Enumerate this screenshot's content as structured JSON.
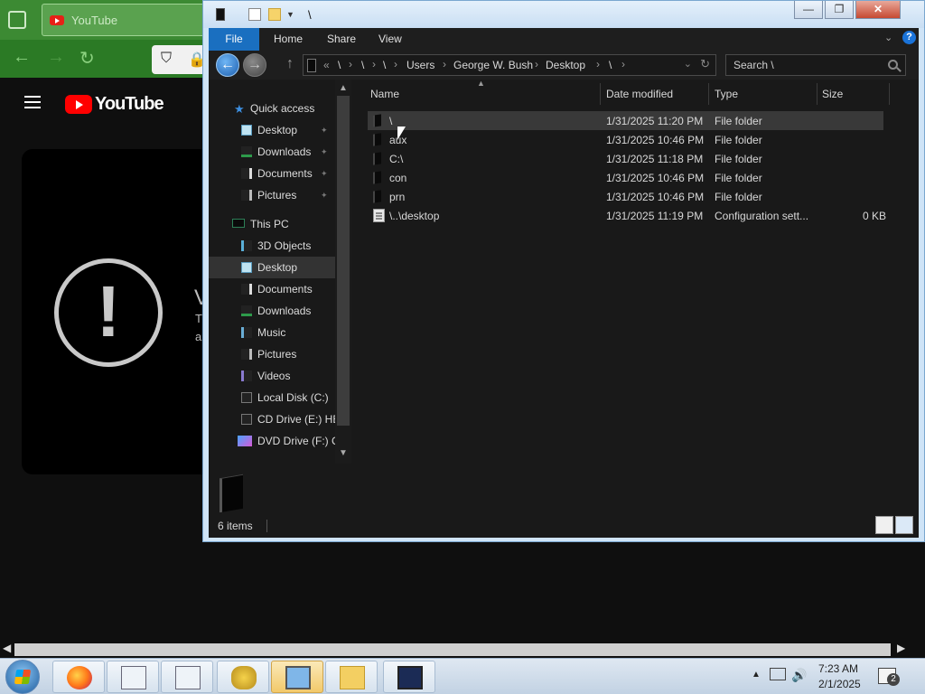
{
  "browser": {
    "tab_title": "YouTube",
    "page_logo": "YouTube",
    "error_partial_1": "V",
    "error_partial_2": "T",
    "error_partial_3": "a"
  },
  "explorer": {
    "title": "\\",
    "ribbon_tabs": [
      "File",
      "Home",
      "Share",
      "View"
    ],
    "address": {
      "prefix": "«",
      "crumbs": [
        "\\",
        "\\",
        "\\",
        "Users",
        "George W. Bush",
        "Desktop",
        "\\"
      ]
    },
    "search_placeholder": "Search \\",
    "nav": {
      "quick_access": "Quick access",
      "quick_items": [
        "Desktop",
        "Downloads",
        "Documents",
        "Pictures"
      ],
      "this_pc": "This PC",
      "pc_items": [
        "3D Objects",
        "Desktop",
        "Documents",
        "Downloads",
        "Music",
        "Pictures",
        "Videos",
        "Local Disk (C:)",
        "CD Drive (E:) HB",
        "DVD Drive (F:) C"
      ]
    },
    "columns": [
      "Name",
      "Date modified",
      "Type",
      "Size"
    ],
    "files": [
      {
        "name": "\\",
        "date": "1/31/2025 11:20 PM",
        "type": "File folder",
        "size": ""
      },
      {
        "name": "aux",
        "date": "1/31/2025 10:46 PM",
        "type": "File folder",
        "size": ""
      },
      {
        "name": "C:\\",
        "date": "1/31/2025 11:18 PM",
        "type": "File folder",
        "size": ""
      },
      {
        "name": "con",
        "date": "1/31/2025 10:46 PM",
        "type": "File folder",
        "size": ""
      },
      {
        "name": "prn",
        "date": "1/31/2025 10:46 PM",
        "type": "File folder",
        "size": ""
      },
      {
        "name": "\\..\\desktop",
        "date": "1/31/2025 11:19 PM",
        "type": "Configuration sett...",
        "size": "0 KB"
      }
    ],
    "status": "6 items"
  },
  "taskbar": {
    "time": "7:23 AM",
    "date": "2/1/2025",
    "notification_count": "2"
  }
}
